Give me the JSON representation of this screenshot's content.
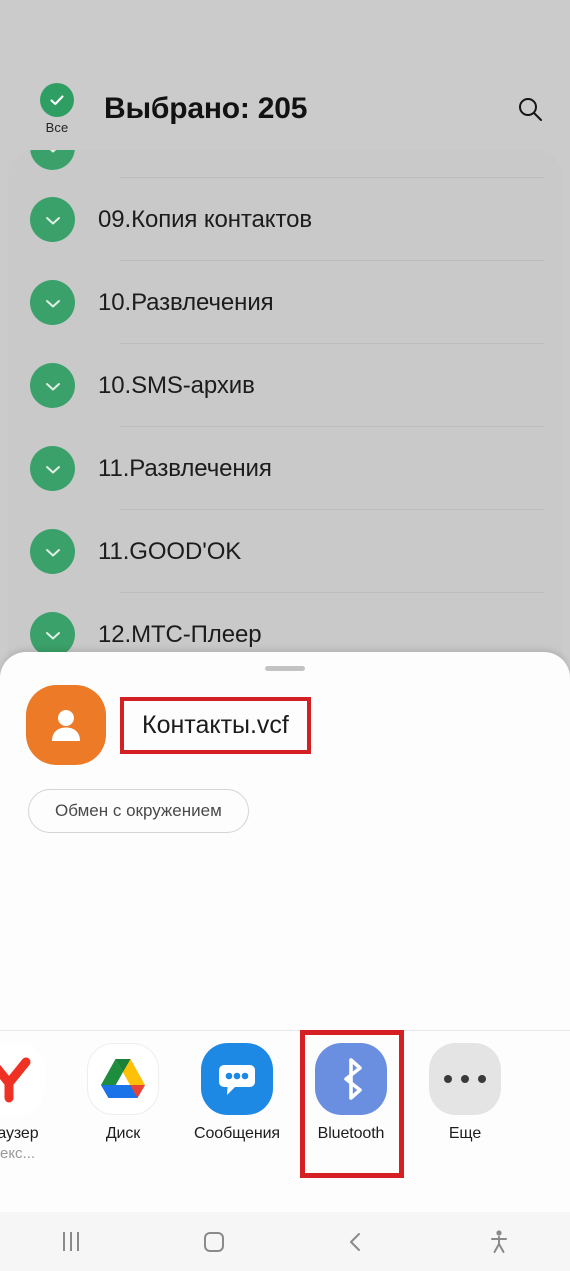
{
  "app": {
    "select_all_label": "Все",
    "title": "Выбрано: 205",
    "search_icon": "search-icon",
    "list_items": [
      {
        "label": "",
        "partial": true
      },
      {
        "label": "09.Копия контактов"
      },
      {
        "label": "10.Развлечения"
      },
      {
        "label": "10.SMS-архив"
      },
      {
        "label": "11.Развлечения"
      },
      {
        "label": "11.GOOD'OK"
      },
      {
        "label": "12.МТС-Плеер"
      }
    ]
  },
  "share_sheet": {
    "file_name": "Контакты.vcf",
    "file_icon": "contact-avatar-icon",
    "nearby_share_label": "Обмен с окружением",
    "apps": [
      {
        "label": "браузер",
        "sublabel": "ндекс...",
        "icon": "yandex-browser-icon",
        "highlighted": false
      },
      {
        "label": "Диск",
        "sublabel": "",
        "icon": "google-drive-icon",
        "highlighted": false
      },
      {
        "label": "Сообщения",
        "sublabel": "",
        "icon": "messages-icon",
        "highlighted": false
      },
      {
        "label": "Bluetooth",
        "sublabel": "",
        "icon": "bluetooth-icon",
        "highlighted": true
      },
      {
        "label": "Еще",
        "sublabel": "",
        "icon": "more-dots-icon",
        "highlighted": false
      }
    ]
  },
  "navbar": {
    "recents": "recents-icon",
    "home": "home-icon",
    "back": "back-icon",
    "accessibility": "accessibility-icon"
  },
  "colors": {
    "check_green": "#2f9e63",
    "highlight_red": "#d32024",
    "avatar_orange": "#ec7a26",
    "bluetooth_blue": "#6a8ee0",
    "messages_blue": "#1e88e5"
  }
}
